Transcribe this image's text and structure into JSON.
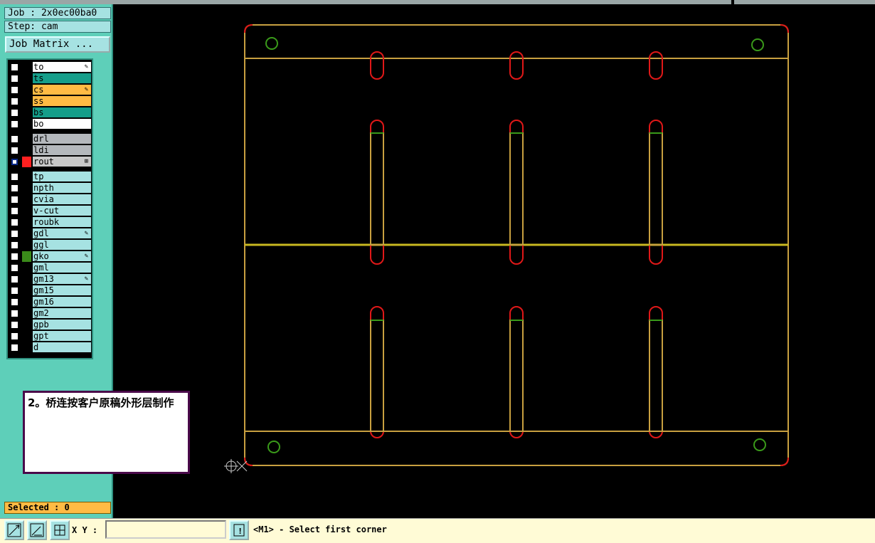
{
  "job_label": "Job : 2x0ec00ba0",
  "step_label": "Step: cam",
  "job_matrix_button": "Job Matrix ...",
  "layers_group1": [
    {
      "name": "to",
      "bg": "#ffffff",
      "edit": "✎"
    },
    {
      "name": "ts",
      "bg": "#159e8a",
      "edit": ""
    },
    {
      "name": "cs",
      "bg": "#ffbb44",
      "edit": "✎"
    },
    {
      "name": "ss",
      "bg": "#ffbb44",
      "edit": ""
    },
    {
      "name": "bs",
      "bg": "#159e8a",
      "edit": ""
    },
    {
      "name": "bo",
      "bg": "#ffffff",
      "edit": ""
    }
  ],
  "layers_group2": [
    {
      "name": "drl",
      "bg": "#b4b8bc",
      "edit": ""
    },
    {
      "name": "ldi",
      "bg": "#b4b8bc",
      "edit": ""
    },
    {
      "name": "rout",
      "bg": "#c8c8c8",
      "edit": "⊞"
    }
  ],
  "layers_group3": [
    {
      "name": "tp",
      "edit": ""
    },
    {
      "name": "npth",
      "edit": ""
    },
    {
      "name": "cvia",
      "edit": ""
    },
    {
      "name": "v-cut",
      "edit": ""
    },
    {
      "name": "roubk",
      "edit": ""
    },
    {
      "name": "gdl",
      "edit": "✎"
    },
    {
      "name": "ggl",
      "edit": ""
    },
    {
      "name": "gko",
      "edit": "✎"
    },
    {
      "name": "gml",
      "edit": ""
    },
    {
      "name": "gm13",
      "edit": "✎"
    },
    {
      "name": "gm15",
      "edit": ""
    },
    {
      "name": "gm16",
      "edit": ""
    },
    {
      "name": "gm2",
      "edit": ""
    },
    {
      "name": "gpb",
      "edit": ""
    },
    {
      "name": "gpt",
      "edit": ""
    },
    {
      "name": "d",
      "edit": ""
    }
  ],
  "colors": {
    "panel": "#5ecfb9",
    "layer_default": "#a6e2e2",
    "rout_display": "#ff2020",
    "gko_display": "#3a8a1a",
    "outline": "#c8a040",
    "slot": "#e01818",
    "fiducial": "#3a9a1a"
  },
  "selected_label": "Selected : 0",
  "note_text": "2。桥连按客户原稿外形层制作",
  "xy_label": "X Y :",
  "xy_value": "",
  "message": "<M1> - Select first corner",
  "icons": [
    "zoom-fit-icon",
    "zoom-area-icon",
    "grid-icon",
    "info-icon"
  ]
}
